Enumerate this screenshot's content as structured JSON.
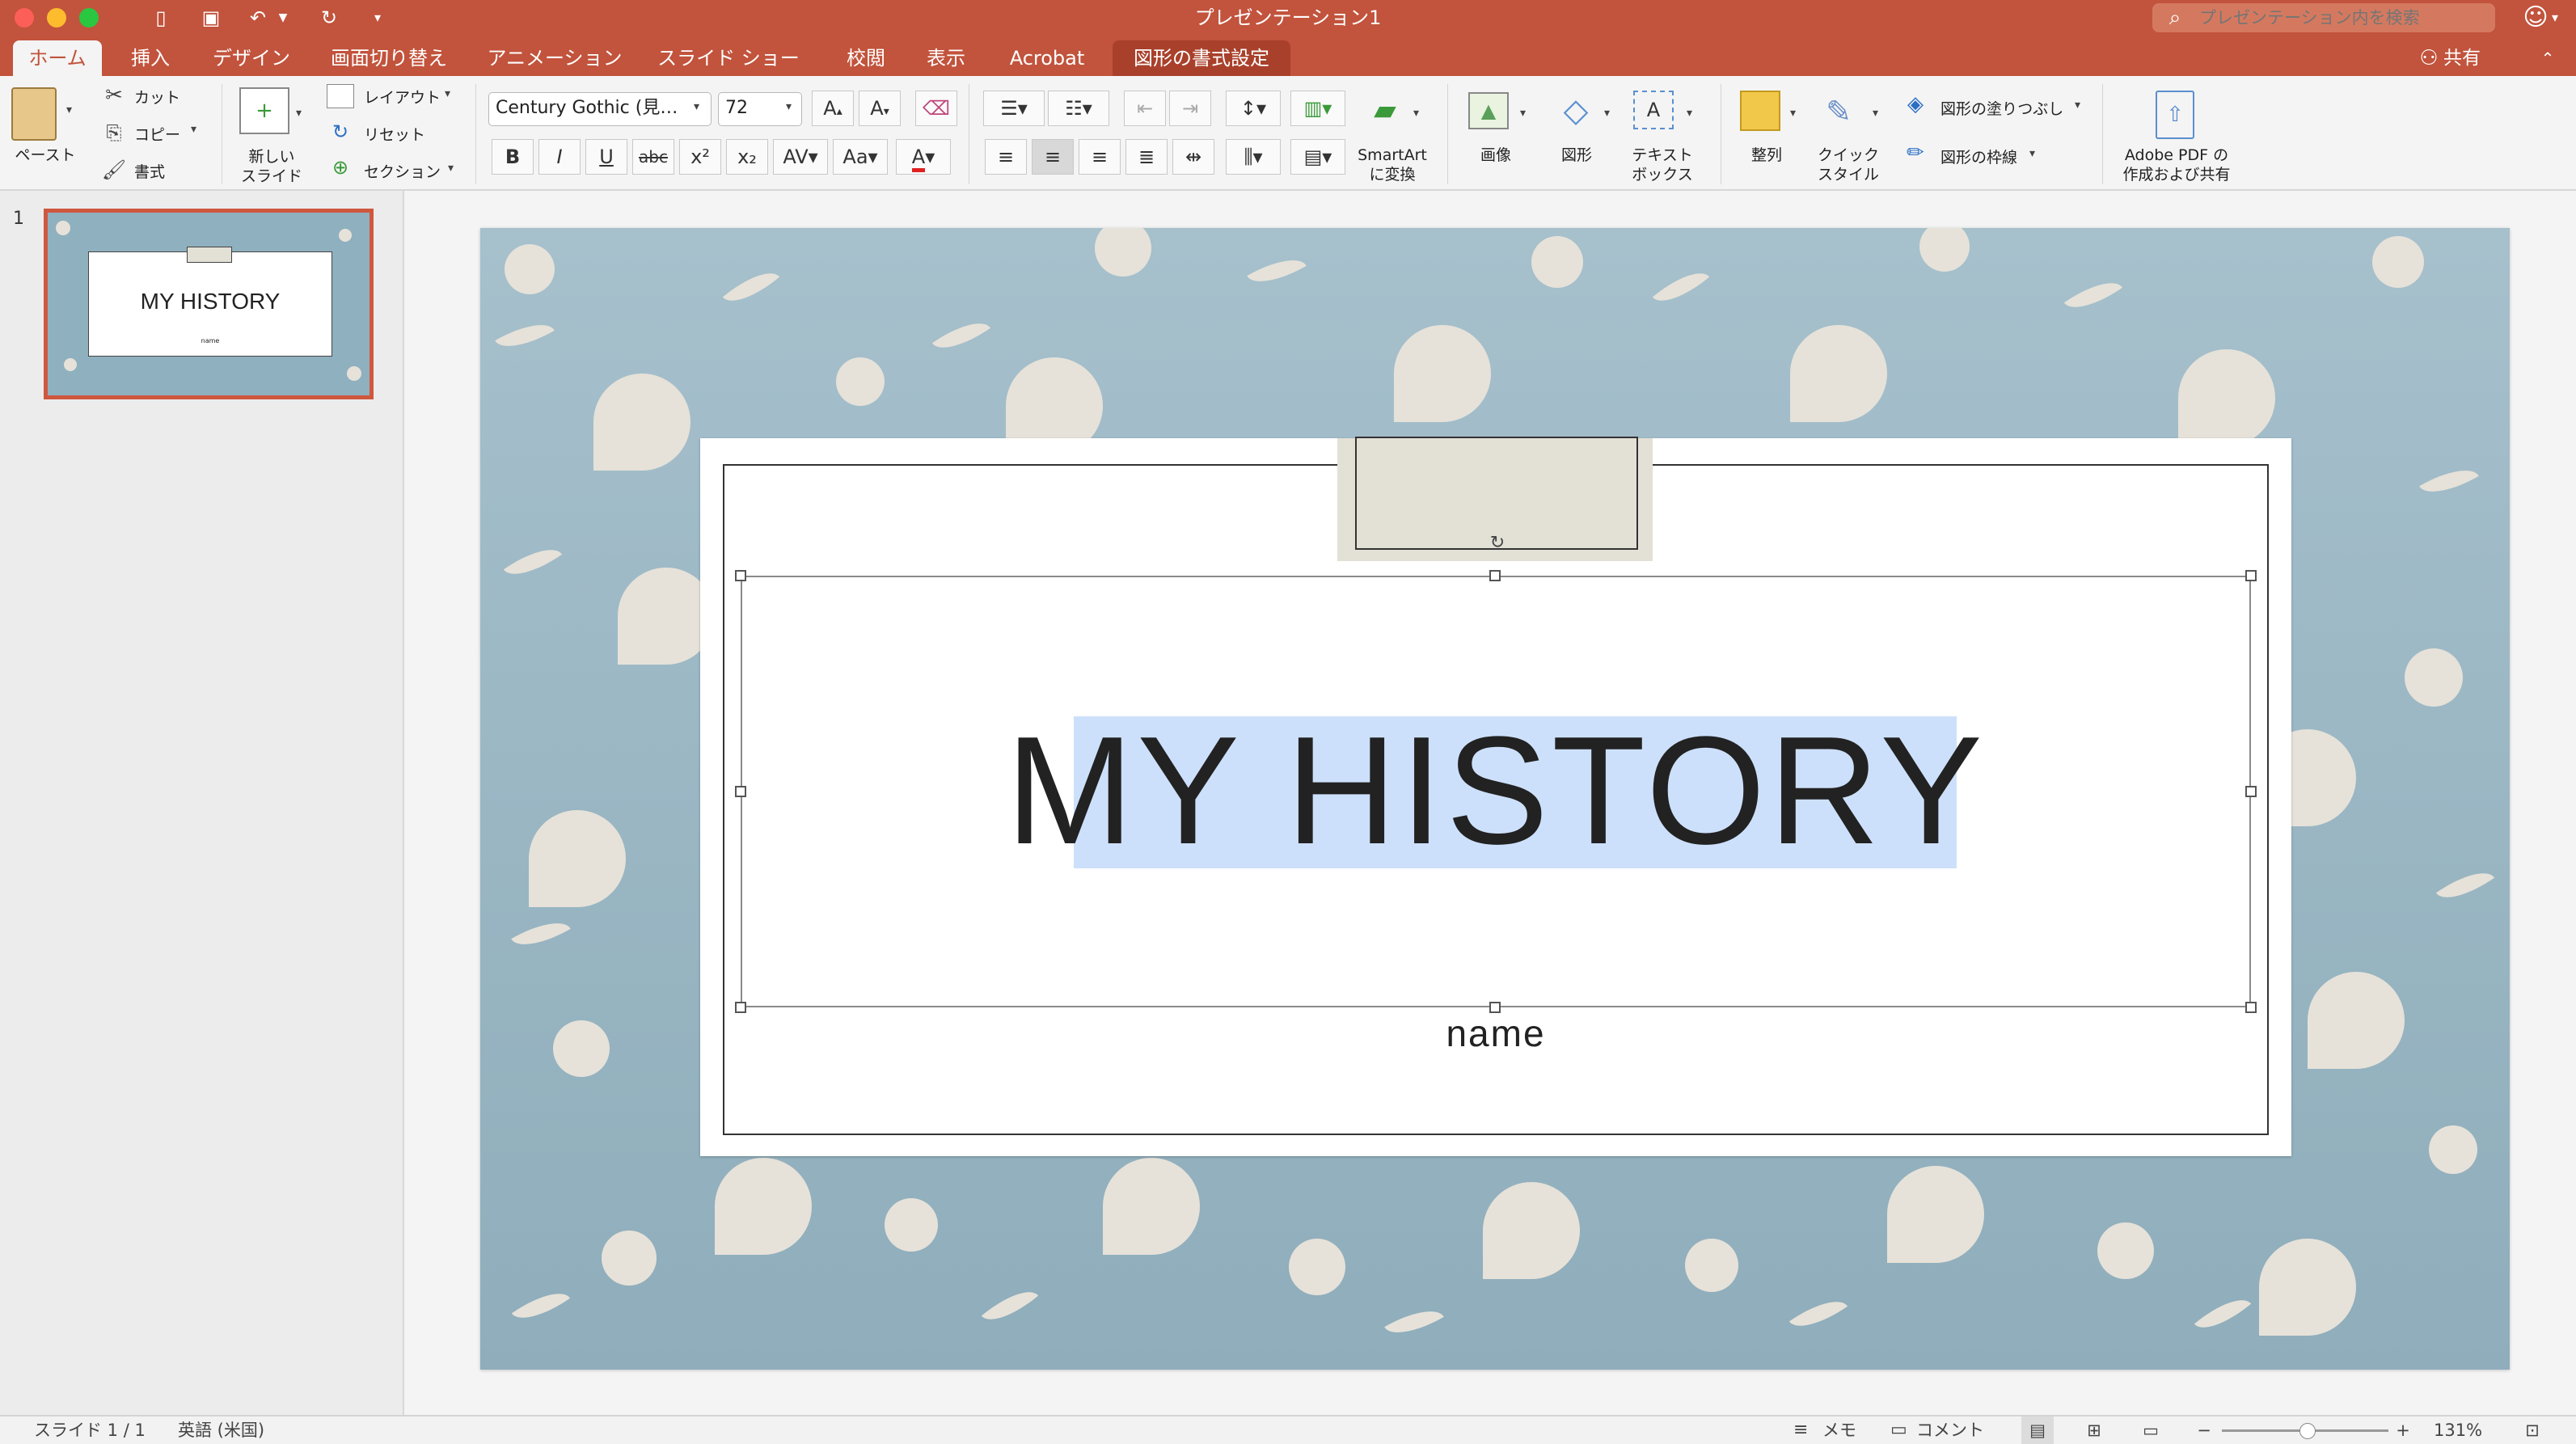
{
  "window": {
    "title": "プレゼンテーション1"
  },
  "search": {
    "placeholder": "プレゼンテーション内を検索"
  },
  "tabs": [
    "ホーム",
    "挿入",
    "デザイン",
    "画面切り替え",
    "アニメーション",
    "スライド ショー",
    "校閲",
    "表示",
    "Acrobat",
    "図形の書式設定"
  ],
  "share_label": "共有",
  "ribbon": {
    "paste": "ペースト",
    "cut": "カット",
    "copy": "コピー",
    "format_painter": "書式",
    "new_slide": "新しい\nスライド",
    "new_slide_l1": "新しい",
    "new_slide_l2": "スライド",
    "layout": "レイアウト",
    "reset": "リセット",
    "section": "セクション",
    "font_name": "Century Gothic (見…",
    "font_size": "72",
    "smartart_l1": "SmartArt",
    "smartart_l2": "に変換",
    "picture": "画像",
    "shapes": "図形",
    "textbox_l1": "テキスト",
    "textbox_l2": "ボックス",
    "arrange": "整列",
    "quick_style_l1": "クイック",
    "quick_style_l2": "スタイル",
    "shape_fill": "図形の塗りつぶし",
    "shape_outline": "図形の枠線",
    "adobe_l1": "Adobe PDF の",
    "adobe_l2": "作成および共有",
    "bold": "B",
    "italic": "I",
    "underline": "U",
    "strike": "abc"
  },
  "slide_panel": {
    "number": "1",
    "thumb_title": "MY HISTORY",
    "thumb_subtitle": "name"
  },
  "slide": {
    "title": "MY HISTORY",
    "subtitle": "name"
  },
  "status": {
    "slide_count": "スライド 1 / 1",
    "language": "英語 (米国)",
    "notes": "メモ",
    "comments": "コメント",
    "zoom": "131%"
  },
  "colors": {
    "accent": "#c2533c",
    "slide_bg": "#9ab6c3",
    "pattern": "#e6e2d9",
    "selection": "#cde0fb"
  }
}
